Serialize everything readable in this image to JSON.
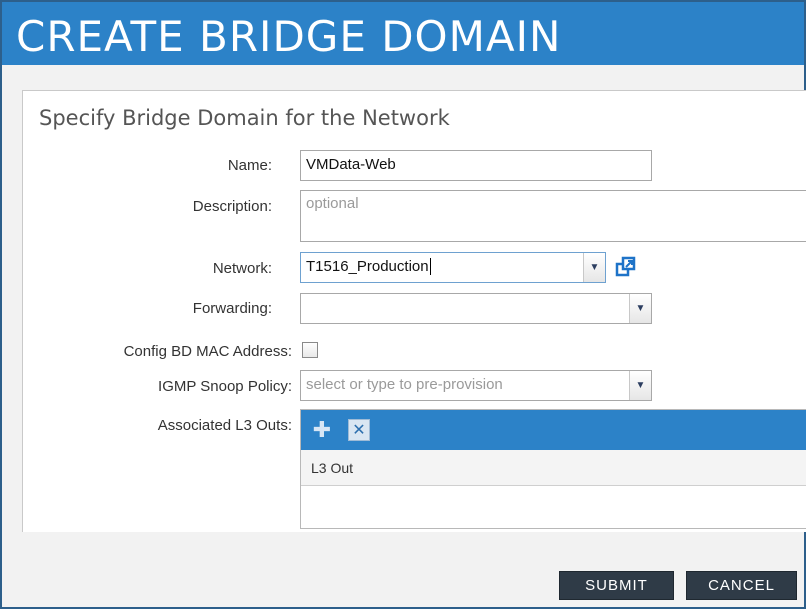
{
  "dialog": {
    "title": "CREATE BRIDGE DOMAIN",
    "panel_title": "Specify Bridge Domain for the Network"
  },
  "form": {
    "name_label": "Name:",
    "name_value": "VMData-Web",
    "description_label": "Description:",
    "description_placeholder": "optional",
    "network_label": "Network:",
    "network_value": "T1516_Production",
    "forwarding_label": "Forwarding:",
    "forwarding_value": "",
    "config_mac_label": "Config BD MAC Address:",
    "config_mac_checked": false,
    "igmp_label": "IGMP Snoop Policy:",
    "igmp_placeholder": "select or type to pre-provision",
    "l3outs_label": "Associated L3 Outs:",
    "l3outs_column": "L3 Out",
    "l3outs_rows": []
  },
  "icons": {
    "dropdown": "chevron-down-icon",
    "open_external": "open-external-icon",
    "add": "plus-icon",
    "delete": "close-icon"
  },
  "buttons": {
    "submit": "SUBMIT",
    "cancel": "CANCEL"
  },
  "colors": {
    "title_bar": "#2c82c8",
    "button_bg": "#2f3b47",
    "toolbar": "#2c82c8"
  }
}
